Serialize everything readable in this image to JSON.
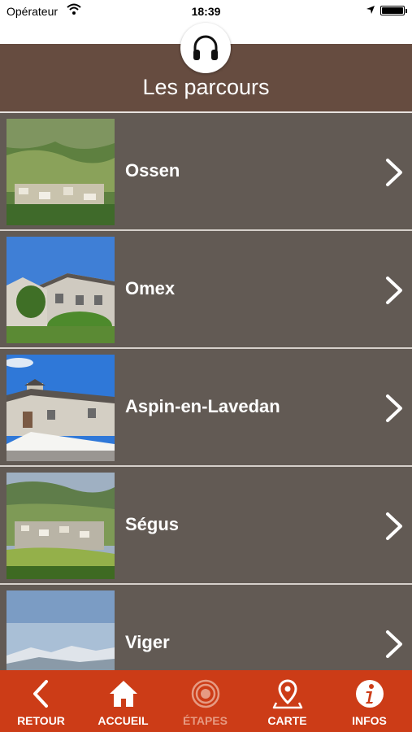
{
  "status_bar": {
    "carrier": "Opérateur",
    "time": "18:39"
  },
  "header": {
    "title": "Les parcours",
    "audio_icon": "headphones-icon"
  },
  "routes": [
    {
      "name": "Ossen"
    },
    {
      "name": "Omex"
    },
    {
      "name": "Aspin-en-Lavedan"
    },
    {
      "name": "Ségus"
    },
    {
      "name": "Viger"
    }
  ],
  "tabbar": {
    "tabs": [
      {
        "label": "RETOUR",
        "icon": "back-chevron-icon",
        "enabled": true
      },
      {
        "label": "ACCUEIL",
        "icon": "home-icon",
        "enabled": true
      },
      {
        "label": "ÉTAPES",
        "icon": "target-icon",
        "enabled": false
      },
      {
        "label": "CARTE",
        "icon": "map-pin-icon",
        "enabled": true
      },
      {
        "label": "INFOS",
        "icon": "info-icon",
        "enabled": true
      }
    ]
  },
  "colors": {
    "header": "#664c40",
    "row": "#625a54",
    "tabbar": "#cc3c17"
  }
}
